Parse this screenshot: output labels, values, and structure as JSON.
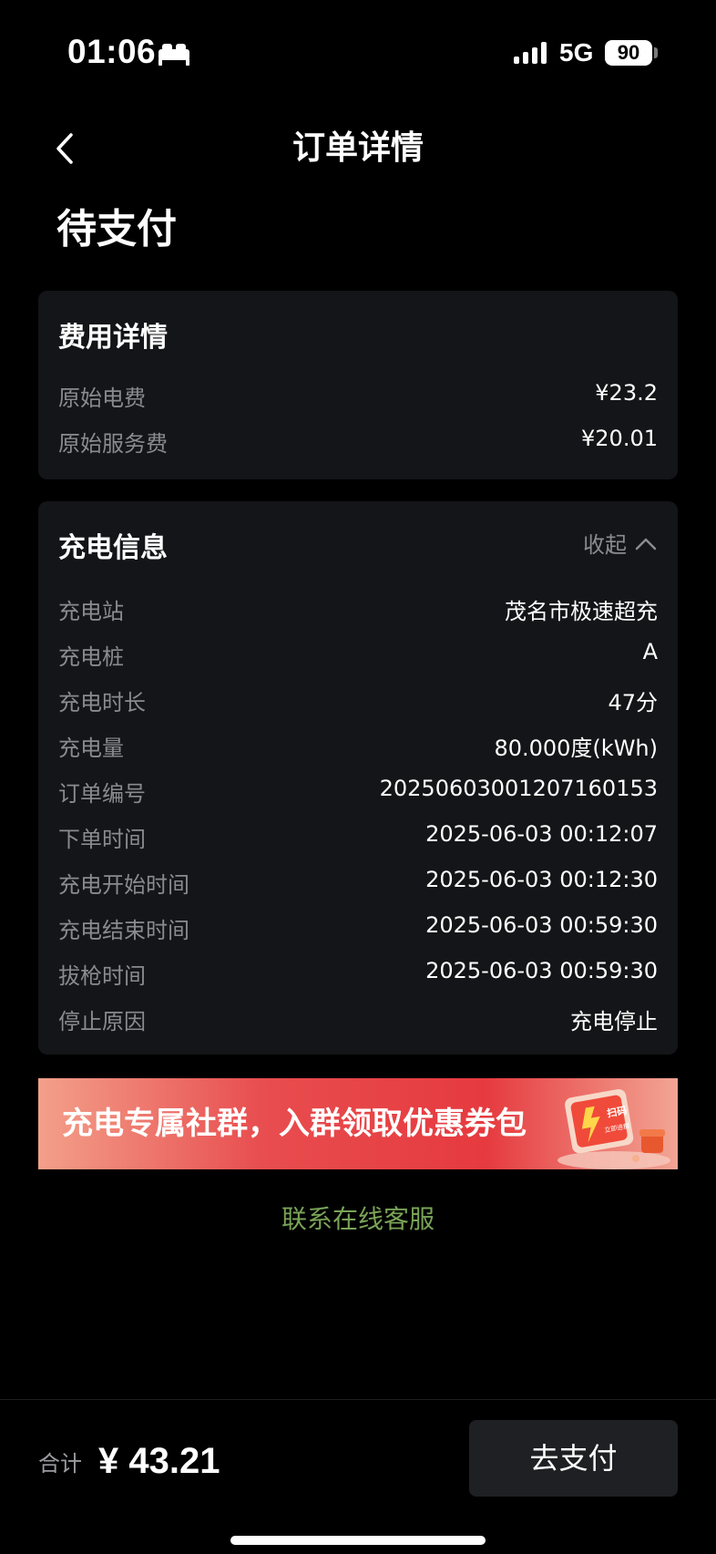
{
  "status_bar": {
    "time": "01:06",
    "network": "5G",
    "battery": "90"
  },
  "nav": {
    "title": "订单详情"
  },
  "order_status": "待支付",
  "fee_details": {
    "title": "费用详情",
    "rows": [
      {
        "label": "原始电费",
        "value": "¥23.2"
      },
      {
        "label": "原始服务费",
        "value": "¥20.01"
      }
    ]
  },
  "charge_info": {
    "title": "充电信息",
    "collapse_label": "收起",
    "rows": [
      {
        "label": "充电站",
        "value": "茂名市极速超充"
      },
      {
        "label": "充电桩",
        "value": "A"
      },
      {
        "label": "充电时长",
        "value": "47分"
      },
      {
        "label": "充电量",
        "value": "80.000度(kWh)"
      },
      {
        "label": "订单编号",
        "value": "20250603001207160153"
      },
      {
        "label": "下单时间",
        "value": "2025-06-03 00:12:07"
      },
      {
        "label": "充电开始时间",
        "value": "2025-06-03 00:12:30"
      },
      {
        "label": "充电结束时间",
        "value": "2025-06-03 00:59:30"
      },
      {
        "label": "拔枪时间",
        "value": "2025-06-03 00:59:30"
      },
      {
        "label": "停止原因",
        "value": "充电停止"
      }
    ]
  },
  "promo": {
    "text": "充电专属社群，入群领取优惠券包",
    "badge_top": "扫码",
    "badge_bottom": "立即进群"
  },
  "contact_label": "联系在线客服",
  "footer": {
    "total_label": "合计",
    "total_amount": "¥ 43.21",
    "pay_label": "去支付"
  },
  "colors": {
    "background": "#000000",
    "card": "#141518",
    "muted_text": "#8a8b8f",
    "contact_green": "#79a357",
    "banner_red": "#e63a3f"
  }
}
